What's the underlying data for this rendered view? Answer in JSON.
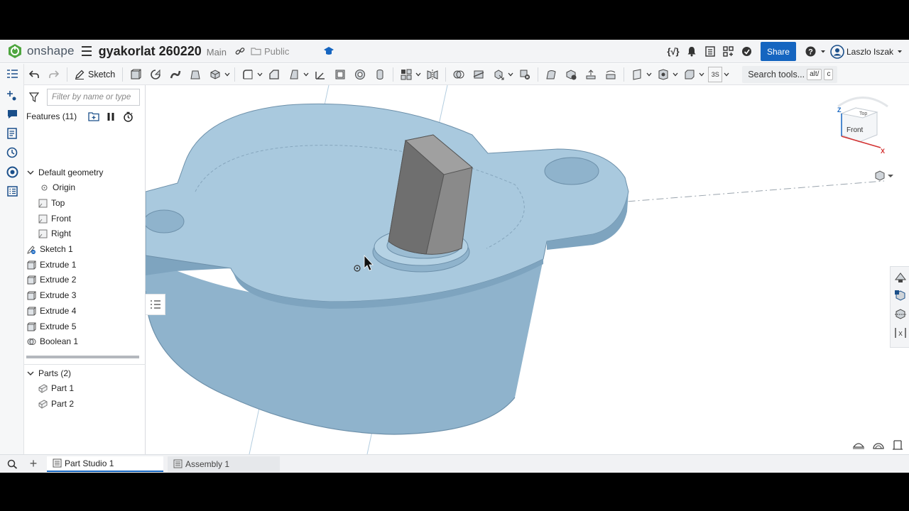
{
  "header": {
    "logo_text": "onshape",
    "doc_title": "gyakorlat 260220",
    "branch": "Main",
    "visibility": "Public",
    "share_label": "Share",
    "user_name": "Laszlo Iszak"
  },
  "toolbar": {
    "sketch_label": "Sketch",
    "view_label": "3S",
    "search_label": "Search tools...",
    "search_shortcut_1": "alt/",
    "search_shortcut_2": "c"
  },
  "feature_panel": {
    "filter_placeholder": "Filter by name or type",
    "features_header": "Features (11)",
    "default_geometry": "Default geometry",
    "items": [
      {
        "label": "Origin"
      },
      {
        "label": "Top"
      },
      {
        "label": "Front"
      },
      {
        "label": "Right"
      },
      {
        "label": "Sketch 1"
      },
      {
        "label": "Extrude 1"
      },
      {
        "label": "Extrude 2"
      },
      {
        "label": "Extrude 3"
      },
      {
        "label": "Extrude 4"
      },
      {
        "label": "Extrude 5"
      },
      {
        "label": "Boolean 1"
      }
    ],
    "parts_header": "Parts (2)",
    "parts": [
      {
        "label": "Part 1"
      },
      {
        "label": "Part 2"
      }
    ]
  },
  "viewcube": {
    "top_label": "Top",
    "front_label": "Front",
    "z_label": "Z",
    "x_label": "X"
  },
  "tabs": [
    {
      "label": "Part Studio 1"
    },
    {
      "label": "Assembly 1"
    }
  ],
  "colors": {
    "accent": "#1565c0",
    "part_body": "#8fb3cc",
    "part_top": "#a9c9de",
    "shaft": "#7b7b7b"
  }
}
